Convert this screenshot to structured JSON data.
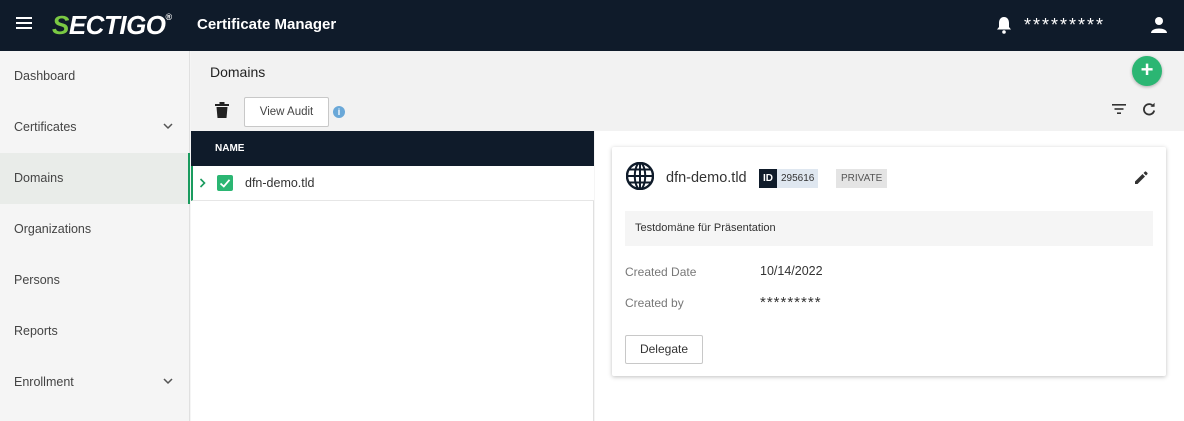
{
  "header": {
    "logo_prefix": "S",
    "logo_rest": "ECTIGO",
    "logo_mark": "®",
    "app_title": "Certificate Manager",
    "username": "*********"
  },
  "sidebar": {
    "items": [
      {
        "label": "Dashboard"
      },
      {
        "label": "Certificates",
        "expandable": true
      },
      {
        "label": "Domains",
        "active": true
      },
      {
        "label": "Organizations"
      },
      {
        "label": "Persons"
      },
      {
        "label": "Reports"
      },
      {
        "label": "Enrollment",
        "expandable": true
      }
    ]
  },
  "page": {
    "title": "Domains",
    "add_symbol": "+",
    "view_audit_label": "View Audit",
    "info_symbol": "i"
  },
  "list": {
    "column_name": "NAME",
    "rows": [
      {
        "name": "dfn-demo.tld",
        "checked": true
      }
    ]
  },
  "detail": {
    "name": "dfn-demo.tld",
    "id_label": "ID",
    "id_value": "295616",
    "visibility": "PRIVATE",
    "description": "Testdomäne für Präsentation",
    "created_date_label": "Created Date",
    "created_date_value": "10/14/2022",
    "created_by_label": "Created by",
    "created_by_value": "*********",
    "delegate_label": "Delegate"
  },
  "colors": {
    "topbar": "#0f1b2a",
    "accent": "#2bb673",
    "logo_accent": "#7ac943"
  }
}
